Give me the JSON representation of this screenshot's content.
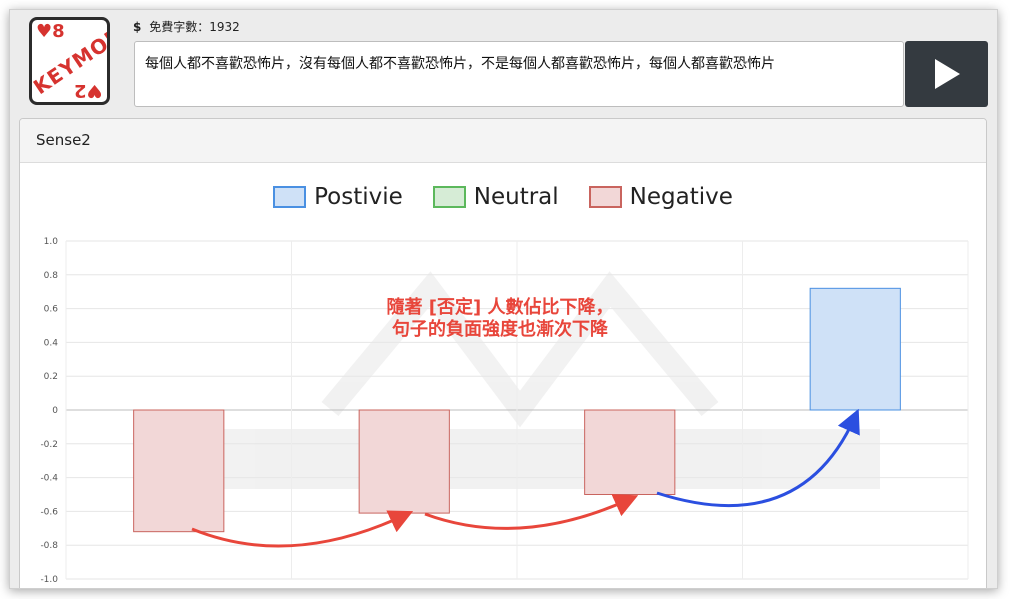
{
  "app": {
    "logo_text": "KEYMOJI",
    "logo_corner_top": "♥8",
    "logo_corner_bottom": "♥2"
  },
  "header": {
    "count_icon": "dollar-icon",
    "count_label": "免費字數：1932",
    "input_value": "每個人都不喜歡恐怖片，沒有每個人都不喜歡恐怖片，不是每個人都喜歡恐怖片，每個人都喜歡恐怖片",
    "play_icon": "play-icon"
  },
  "panel": {
    "title": "Sense2",
    "annotation_line1": "隨著 [否定] 人數佔比下降，",
    "annotation_line2": "句子的負面強度也漸次下降"
  },
  "legend": [
    {
      "label": "Postivie",
      "fill": "#cfe1f7",
      "stroke": "#4a90e2"
    },
    {
      "label": "Neutral",
      "fill": "#d6ecd6",
      "stroke": "#5cb85c"
    },
    {
      "label": "Negative",
      "fill": "#f2d7d7",
      "stroke": "#c9645e"
    }
  ],
  "chart_data": {
    "type": "bar",
    "categories": [
      "",
      "",
      "",
      ""
    ],
    "series": [
      {
        "name": "Postivie",
        "values": [
          0,
          0,
          0,
          0.72
        ]
      },
      {
        "name": "Neutral",
        "values": [
          0,
          0,
          0,
          0
        ]
      },
      {
        "name": "Negative",
        "values": [
          -0.72,
          -0.61,
          -0.5,
          0
        ]
      }
    ],
    "yticks": [
      "1.0",
      "0.8",
      "0.6",
      "0.4",
      "0.2",
      "0",
      "-0.2",
      "-0.4",
      "-0.6",
      "-0.8",
      "-1.0"
    ],
    "ylim": [
      -1.0,
      1.0
    ],
    "grid": true
  }
}
